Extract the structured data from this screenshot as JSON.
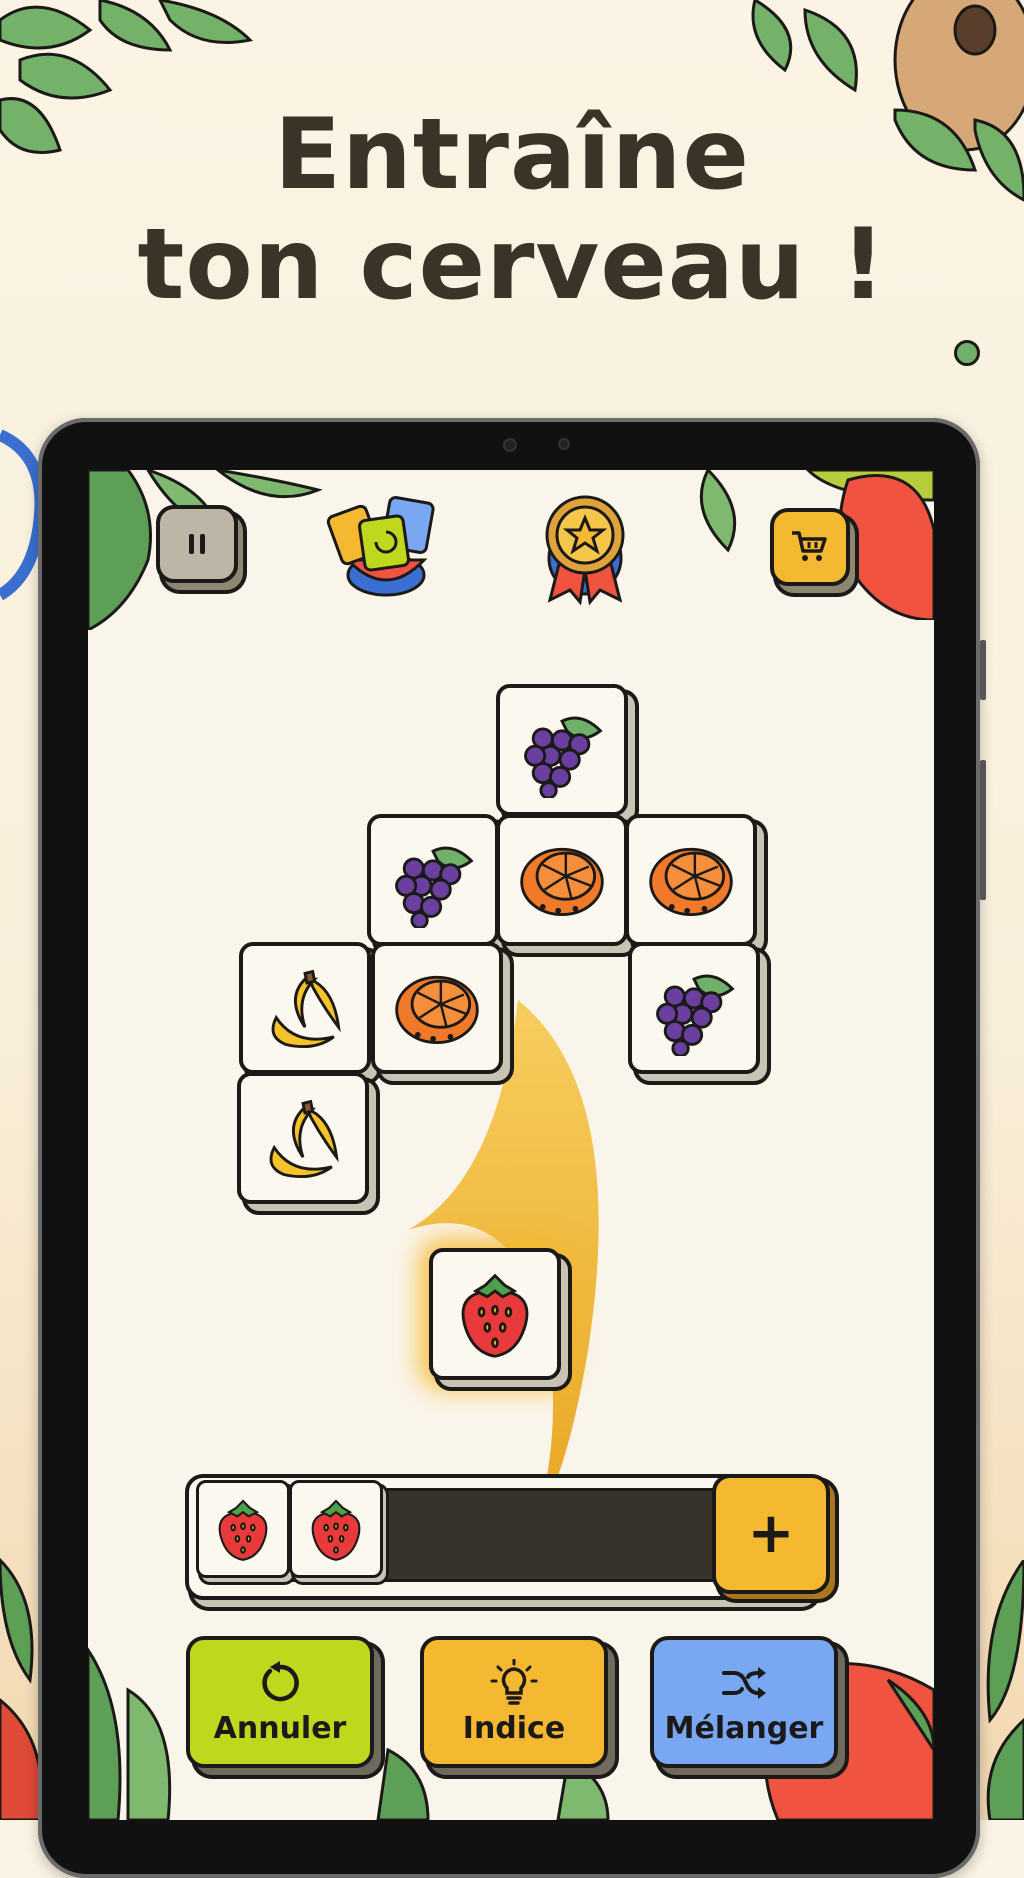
{
  "headline": {
    "line1": "Entraîne",
    "line2": "ton cerveau !"
  },
  "top_bar": {
    "pause_icon": "pause-icon",
    "cards_icon": "cards-bowl-icon",
    "medal_icon": "star-medal-icon",
    "shop_icon": "shopping-cart-icon"
  },
  "board": {
    "tiles": [
      "grapes",
      "grapes",
      "orange",
      "orange",
      "banana",
      "orange",
      "grapes",
      "banana"
    ],
    "moving_tile": "strawberry"
  },
  "tray": {
    "slots_filled": [
      "strawberry",
      "strawberry"
    ],
    "add_label": "+"
  },
  "actions": {
    "undo_label": "Annuler",
    "hint_label": "Indice",
    "shuffle_label": "Mélanger"
  },
  "colors": {
    "undo": "#bfd71c",
    "hint": "#f4b930",
    "shuffle": "#7aa7f2",
    "shop": "#f4b930",
    "pause": "#bdb6a6"
  }
}
